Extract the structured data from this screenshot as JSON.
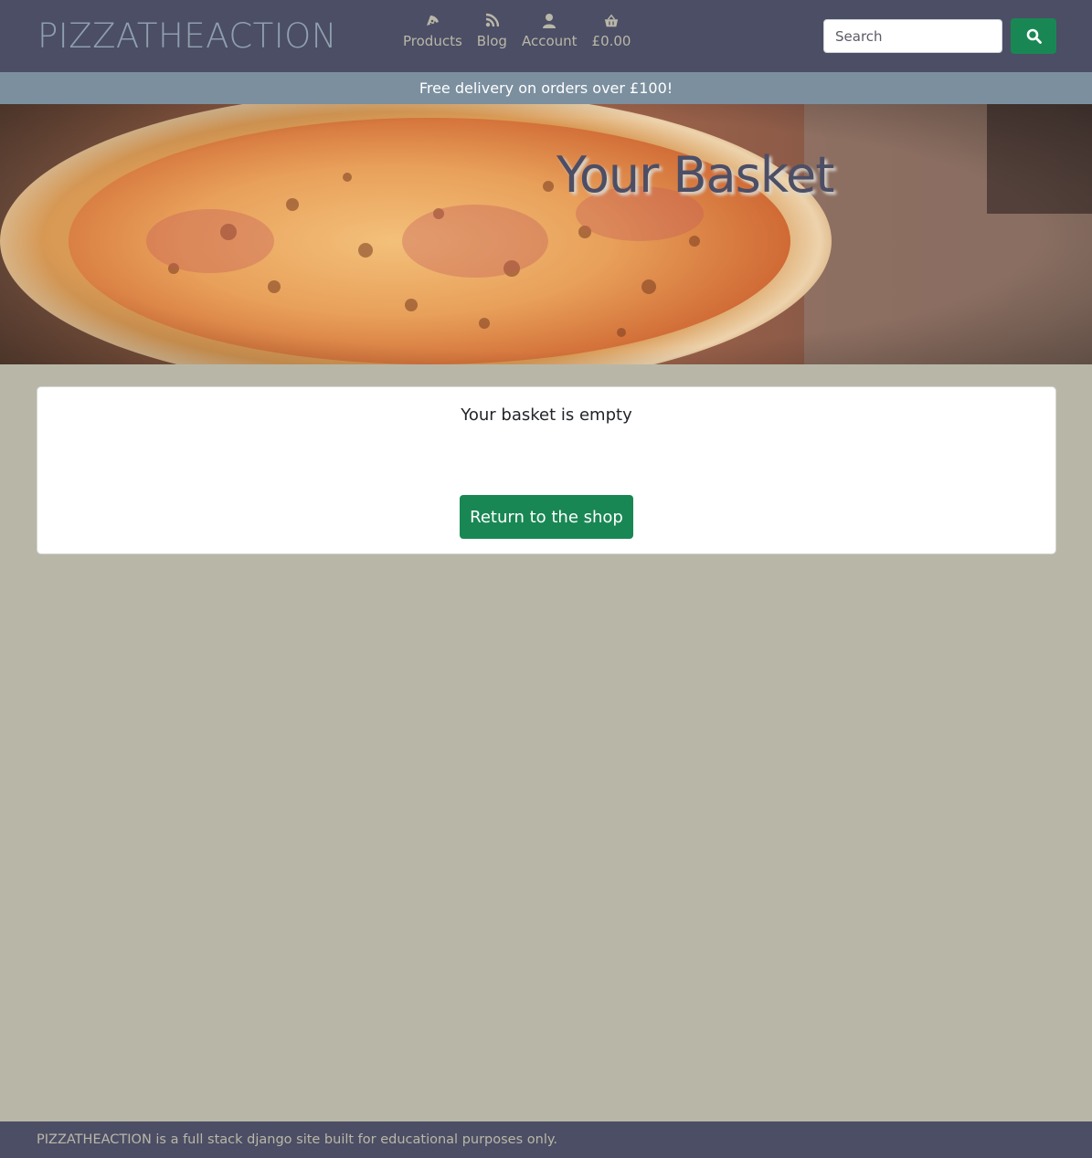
{
  "header": {
    "brand": "PIZZATHEACTION",
    "nav": [
      {
        "label": "Products",
        "icon": "pizza-slice-icon"
      },
      {
        "label": "Blog",
        "icon": "rss-icon"
      },
      {
        "label": "Account",
        "icon": "user-icon"
      },
      {
        "label": "£0.00",
        "icon": "basket-icon"
      }
    ],
    "search": {
      "placeholder": "Search",
      "value": ""
    },
    "search_button_icon": "search-icon"
  },
  "promo": {
    "text": "Free delivery on orders over £100!"
  },
  "hero": {
    "title": "Your Basket"
  },
  "basket": {
    "empty_message": "Your basket is empty",
    "return_button": "Return to the shop"
  },
  "footer": {
    "text": "PIZZATHEACTION is a full stack django site built for educational purposes only."
  },
  "colors": {
    "header_bg": "#4c4e65",
    "brand": "#8ea0af",
    "promo_bg": "#7b8f9f",
    "page_bg": "#b8b7a7",
    "button_green": "#198754",
    "nav_text": "#b9b7a8"
  }
}
